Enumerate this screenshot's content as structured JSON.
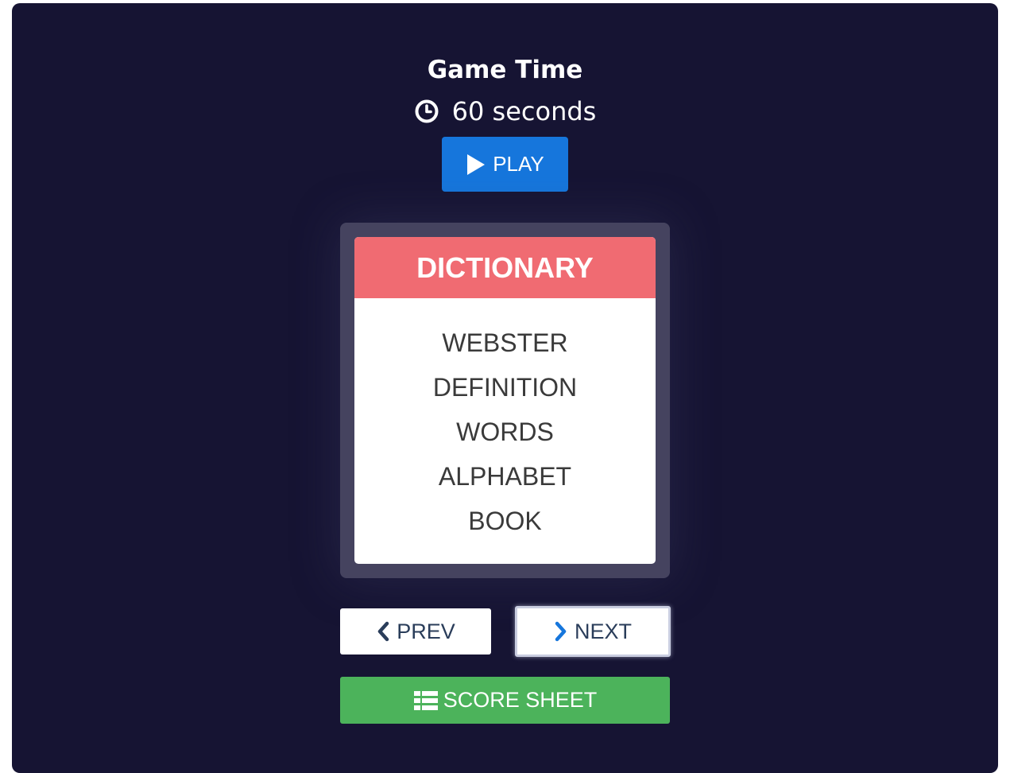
{
  "game": {
    "title": "Game Time",
    "timer_text": "60 seconds",
    "timer_icon": "clock-icon",
    "play_label": "PLAY",
    "play_icon": "play-icon"
  },
  "card": {
    "title": "DICTIONARY",
    "words": [
      "WEBSTER",
      "DEFINITION",
      "WORDS",
      "ALPHABET",
      "BOOK"
    ]
  },
  "navigation": {
    "prev_label": "PREV",
    "prev_icon": "chevron-left-icon",
    "next_label": "NEXT",
    "next_icon": "chevron-right-icon",
    "score_label": "SCORE SHEET",
    "score_icon": "table-icon"
  },
  "colors": {
    "background": "#161433",
    "play_button": "#1676dc",
    "card_header": "#f06b72",
    "score_button": "#4cb35b",
    "card_frame": "#45435f"
  }
}
